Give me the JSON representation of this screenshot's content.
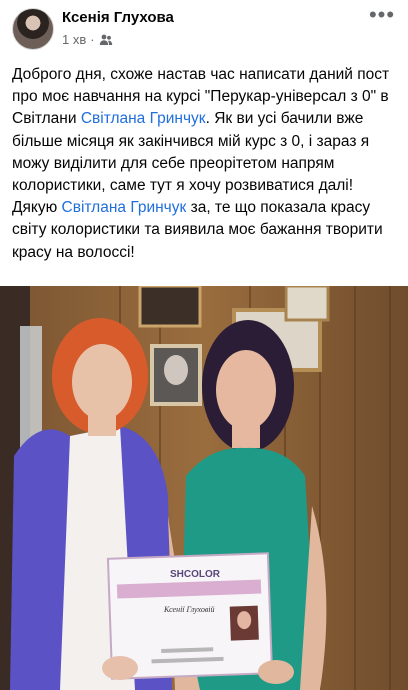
{
  "post": {
    "author": "Ксенія Глухова",
    "time": "1 хв",
    "separator": "·",
    "more_icon": "more-horizontal-icon",
    "audience_icon": "friends-icon",
    "text": {
      "p1": "Доброго дня, схоже настав час написати даний пост про моє навчання на курсі \"Перукар-універсал з 0\" в Світлани ",
      "mention1": "Світлана Гринчук",
      "p2": ". Як ви усі бачили вже більше місяця як закінчився мій курс з 0, і зараз я можу виділити для себе преорітетом напрям колористики, саме тут я хочу розвиватися далі! Дякую ",
      "mention2": "Світлана Гринчук",
      "p3": "  за, те що показала красу світу колористики та виявила моє бажання творити красу на волоссі!"
    },
    "photo": {
      "certificate_brand": "SHCOLOR",
      "certificate_name": "Ксенії Глуховій"
    }
  },
  "colors": {
    "mention": "#216fdb",
    "meta": "#65676b"
  }
}
